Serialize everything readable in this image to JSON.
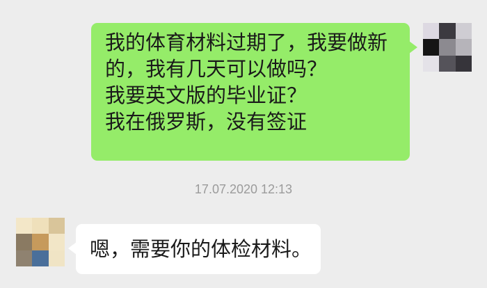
{
  "messages": [
    {
      "sender": "me",
      "lines": [
        "我的体育材料过期了，我要做新",
        "的，我有几天可以做吗？",
        "我要英文版的毕业证？",
        "我在俄罗斯，没有签证"
      ]
    },
    {
      "sender": "them",
      "lines": [
        "嗯，需要你的体检材料。"
      ]
    }
  ],
  "timestamp": "17.07.2020 12:13",
  "colors": {
    "background": "#ededed",
    "outgoing_bubble": "#95ec69",
    "incoming_bubble": "#ffffff",
    "timestamp_text": "#9b9b9b"
  },
  "avatars": {
    "me": [
      "#ddd9e2",
      "#3c3a40",
      "#cfcdd3",
      "#151515",
      "#8c8a90",
      "#b6b4ba",
      "#e4e2e8",
      "#55535a",
      "#36343a"
    ],
    "them": [
      "#f3e7c8",
      "#efe0bb",
      "#d9c59a",
      "#8a7a62",
      "#c69a5c",
      "#f2e6c7",
      "#8f8270",
      "#4a6f9a",
      "#f0e4c5"
    ]
  }
}
